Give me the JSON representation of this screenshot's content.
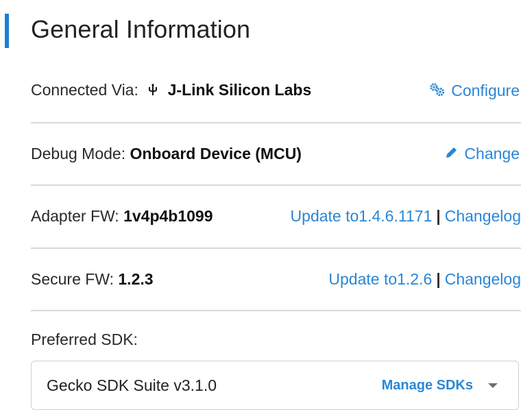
{
  "header": {
    "title": "General Information"
  },
  "rows": [
    {
      "label": "Connected Via:",
      "value": "J-Link Silicon Labs",
      "icon": "usb-icon",
      "action": {
        "label": "Configure",
        "icon": "gears-icon"
      }
    },
    {
      "label": "Debug Mode:",
      "value": "Onboard Device (MCU)",
      "action": {
        "label": "Change",
        "icon": "pencil-icon"
      }
    },
    {
      "label": "Adapter FW:",
      "value": "1v4p4b1099",
      "update_label": "Update to1.4.6.1171",
      "separator": "|",
      "changelog_label": "Changelog"
    },
    {
      "label": "Secure FW:",
      "value": "1.2.3",
      "update_label": "Update to1.2.6",
      "separator": "|",
      "changelog_label": "Changelog"
    }
  ],
  "sdk": {
    "label": "Preferred SDK:",
    "selected": "Gecko SDK Suite v3.1.0",
    "manage_label": "Manage SDKs",
    "caret_icon": "chevron-down-icon"
  },
  "colors": {
    "accent": "#1a7fd4",
    "link": "#2a86d6",
    "divider": "#d8d8d8"
  }
}
